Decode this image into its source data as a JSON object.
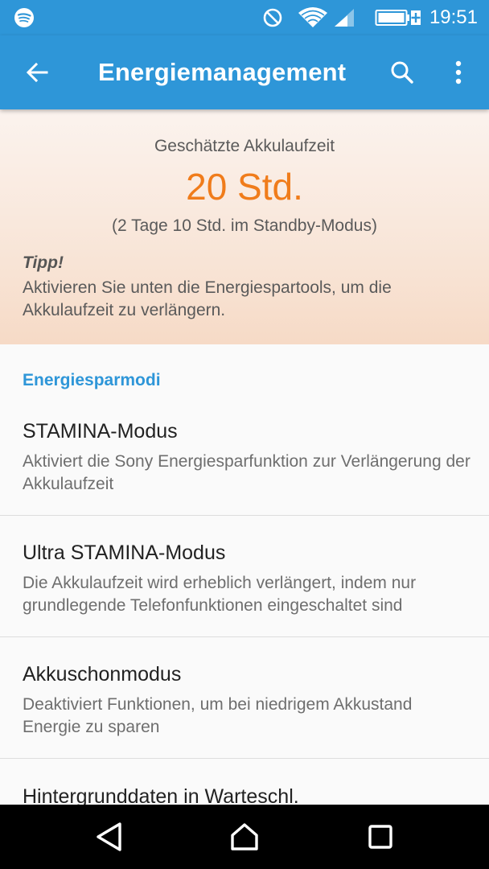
{
  "status_bar": {
    "time": "19:51",
    "icons": [
      "spotify-icon",
      "do-not-disturb-icon",
      "wifi-icon",
      "cell-signal-icon",
      "battery-charging-icon"
    ]
  },
  "app_bar": {
    "title": "Energiemanagement",
    "back_icon": "arrow-back-icon",
    "search_icon": "search-icon",
    "more_icon": "more-vertical-icon"
  },
  "estimate": {
    "label": "Geschätzte Akkulaufzeit",
    "value": "20 Std.",
    "standby": "(2 Tage 10 Std. im Standby-Modus)",
    "tip_title": "Tipp!",
    "tip_text": "Aktivieren Sie unten die Energiespartools, um die Akkulaufzeit zu verlängern."
  },
  "section": {
    "header": "Energiesparmodi",
    "items": [
      {
        "title": "STAMINA-Modus",
        "summary": "Aktiviert die Sony Energiesparfunktion zur Verlängerung der Akkulaufzeit"
      },
      {
        "title": "Ultra STAMINA-Modus",
        "summary": "Die Akkulaufzeit wird erheblich verlängert, indem nur grundlegende Telefonfunktionen eingeschaltet sind"
      },
      {
        "title": "Akkuschonmodus",
        "summary": "Deaktiviert Funktionen, um bei niedrigem Akkustand Energie zu sparen"
      },
      {
        "title": "Hintergrunddaten in Warteschl.",
        "summary": ""
      }
    ]
  },
  "nav_bar": {
    "icons": [
      "nav-back-icon",
      "nav-home-icon",
      "nav-recents-icon"
    ]
  },
  "colors": {
    "primary": "#2e96d8",
    "accent_orange": "#f07c1b",
    "nav_background": "#000000"
  }
}
